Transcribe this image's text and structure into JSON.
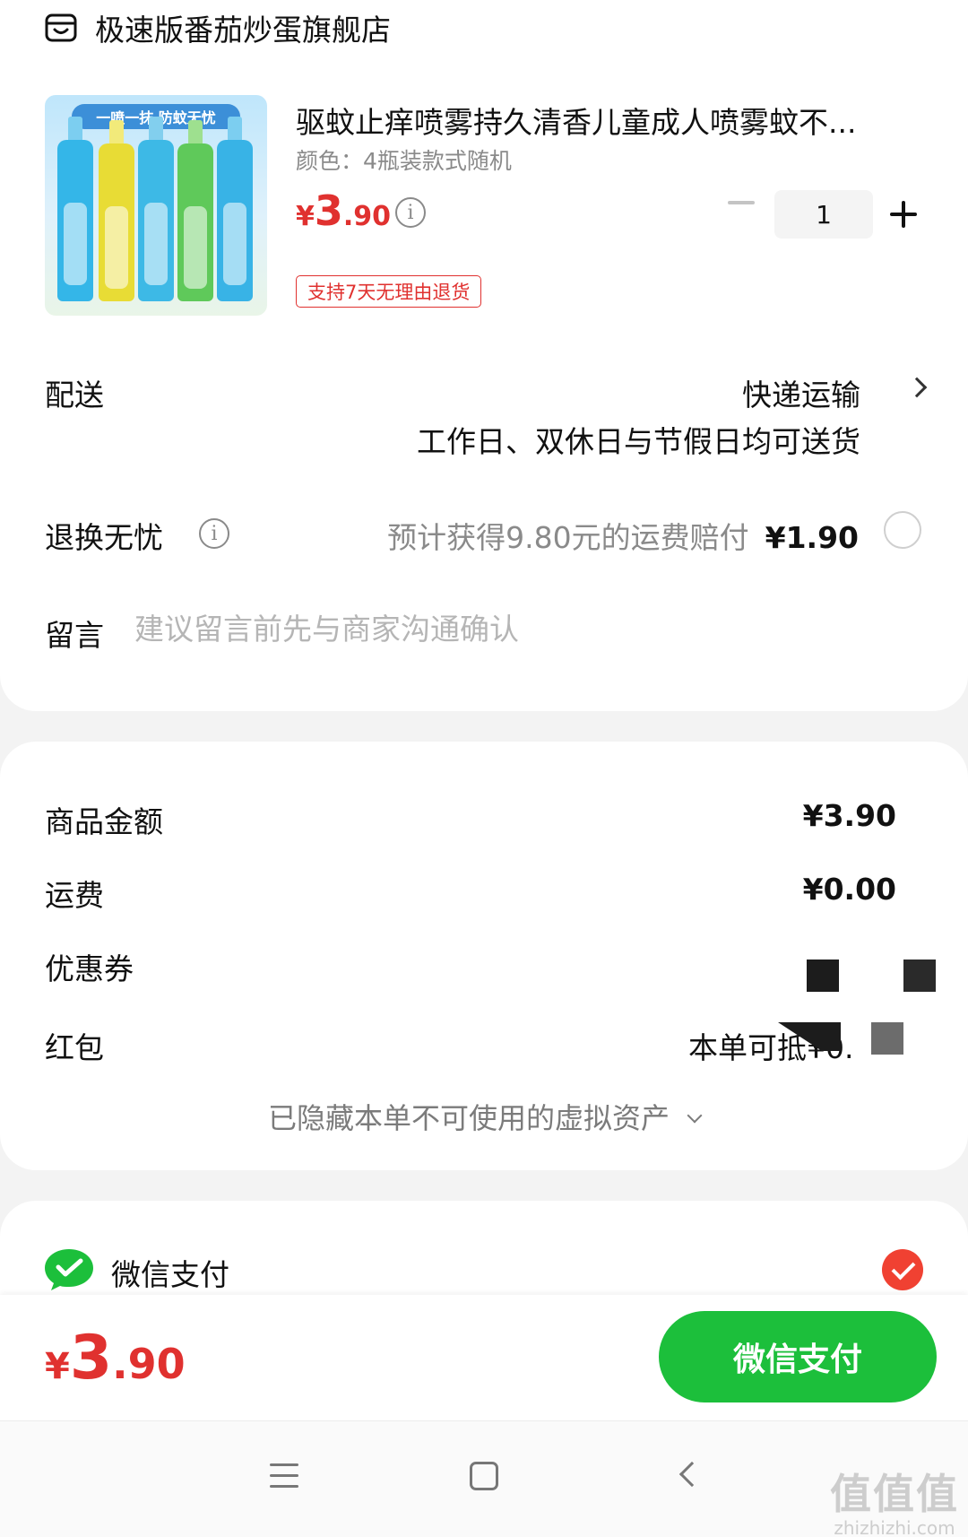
{
  "shop": {
    "icon": "store-icon",
    "name": "极速版番茄炒蛋旗舰店"
  },
  "product": {
    "image_banner": "一喷一抹 防蚊无忧",
    "title": "驱蚊止痒喷雾持久清香儿童成人喷雾蚊不...",
    "spec": "颜色：4瓶装款式随机",
    "price_symbol": "¥",
    "price_int": "3",
    "price_dec": ".90",
    "info_icon": "info-icon",
    "quantity": "1",
    "return_tag": "支持7天无理由退货"
  },
  "delivery": {
    "label": "配送",
    "method": "快递运输",
    "desc": "工作日、双休日与节假日均可送货"
  },
  "hassle_free": {
    "label": "退换无忧",
    "desc": "预计获得9.80元的运费赔付",
    "price": "¥1.90"
  },
  "message": {
    "label": "留言",
    "placeholder": "建议留言前先与商家沟通确认"
  },
  "summary": {
    "goods_label": "商品金额",
    "goods_value": "¥3.90",
    "shipping_label": "运费",
    "shipping_value": "¥0.00",
    "coupon_label": "优惠券",
    "redpack_label": "红包",
    "redpack_value": "本单可抵¥0.",
    "hidden_assets": "已隐藏本单不可使用的虚拟资产"
  },
  "payment": {
    "icon": "wechat-pay-icon",
    "method": "微信支付",
    "selected": true,
    "accent": "#f04132"
  },
  "checkout": {
    "price_symbol": "¥",
    "price_int": "3",
    "price_dec": ".90",
    "button": "微信支付",
    "button_color": "#1cbf3b",
    "price_color": "#e0312f"
  },
  "watermark": {
    "big": "值值值",
    "small": "zhizhizhi.com"
  }
}
